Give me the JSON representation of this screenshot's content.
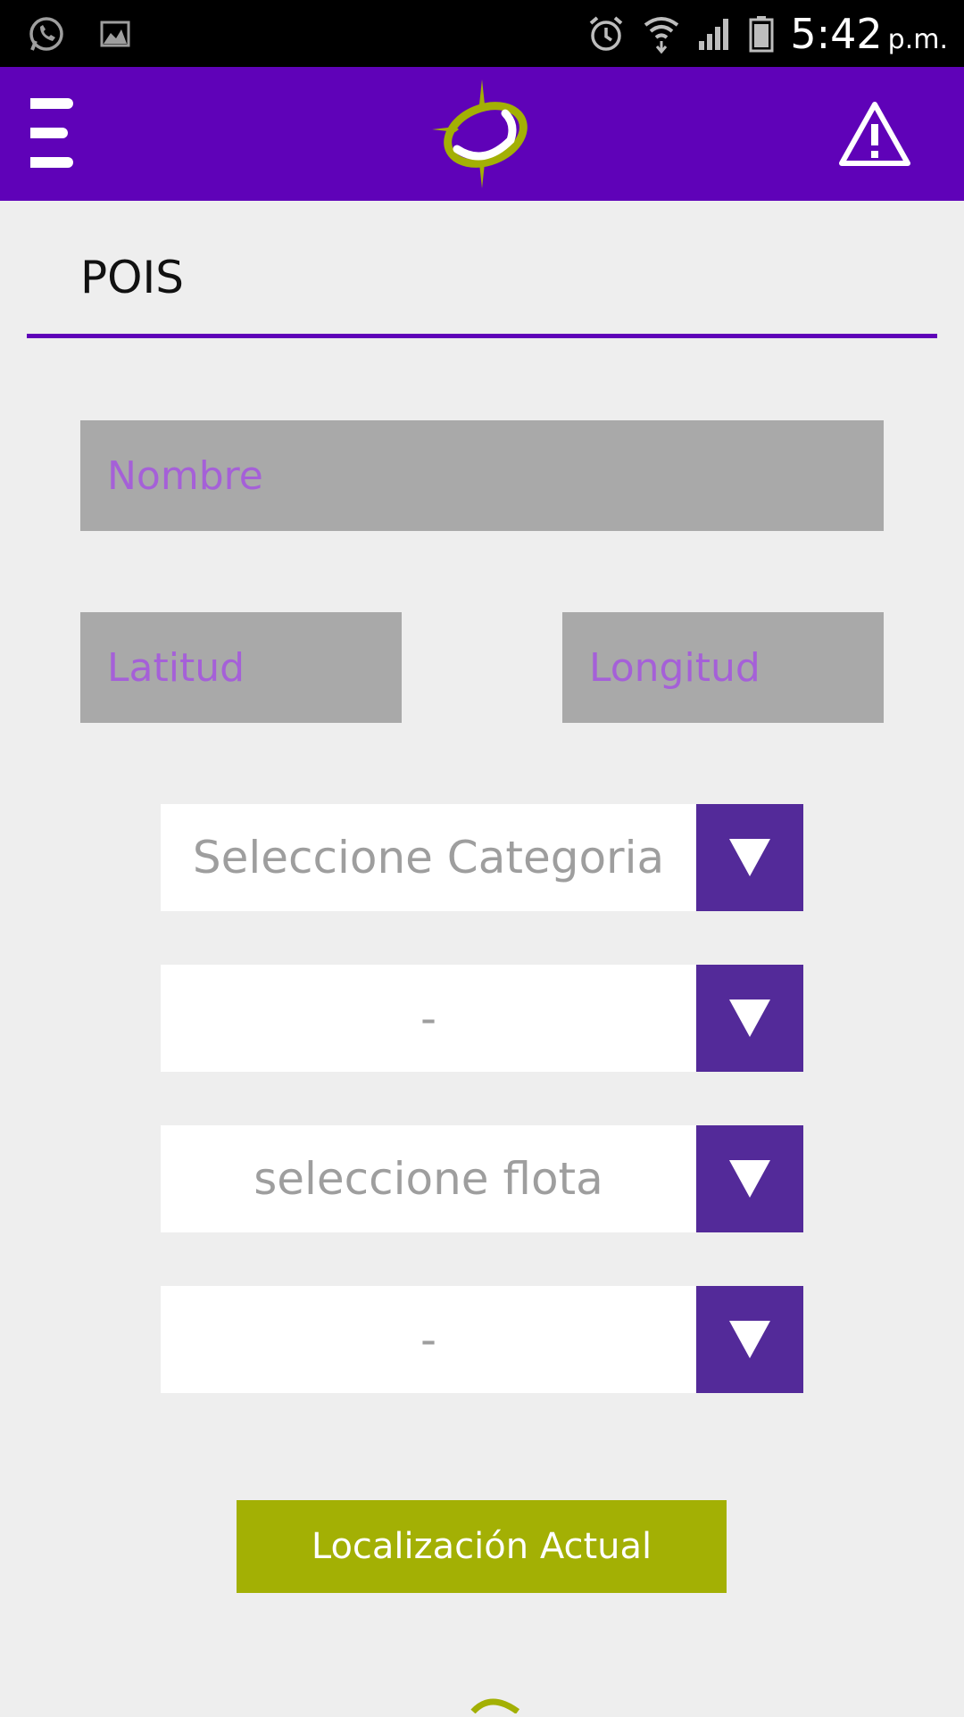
{
  "status_bar": {
    "time": "5:42",
    "ampm": "p.m.",
    "icons": [
      "whatsapp-icon",
      "image-icon",
      "alarm-icon",
      "wifi-icon",
      "signal-icon",
      "battery-icon"
    ]
  },
  "app_bar": {
    "background": "#5f02b8",
    "menu_icon": "menu-icon",
    "logo_icon": "compass-logo-icon",
    "alert_icon": "warning-icon"
  },
  "page": {
    "title": "POIS"
  },
  "form": {
    "name_placeholder": "Nombre",
    "latitude_placeholder": "Latitud",
    "longitude_placeholder": "Longitud",
    "dropdowns": [
      {
        "value": "Seleccione Categoria"
      },
      {
        "value": "-"
      },
      {
        "value": "seleccione flota"
      },
      {
        "value": "-"
      }
    ],
    "location_button_label": "Localización Actual"
  },
  "colors": {
    "accent": "#5f02b8",
    "dropdown_arrow_bg": "#532a99",
    "button_green": "#a3b004",
    "field_gray": "#a9a9a9",
    "placeholder_purple": "#a560d8"
  }
}
